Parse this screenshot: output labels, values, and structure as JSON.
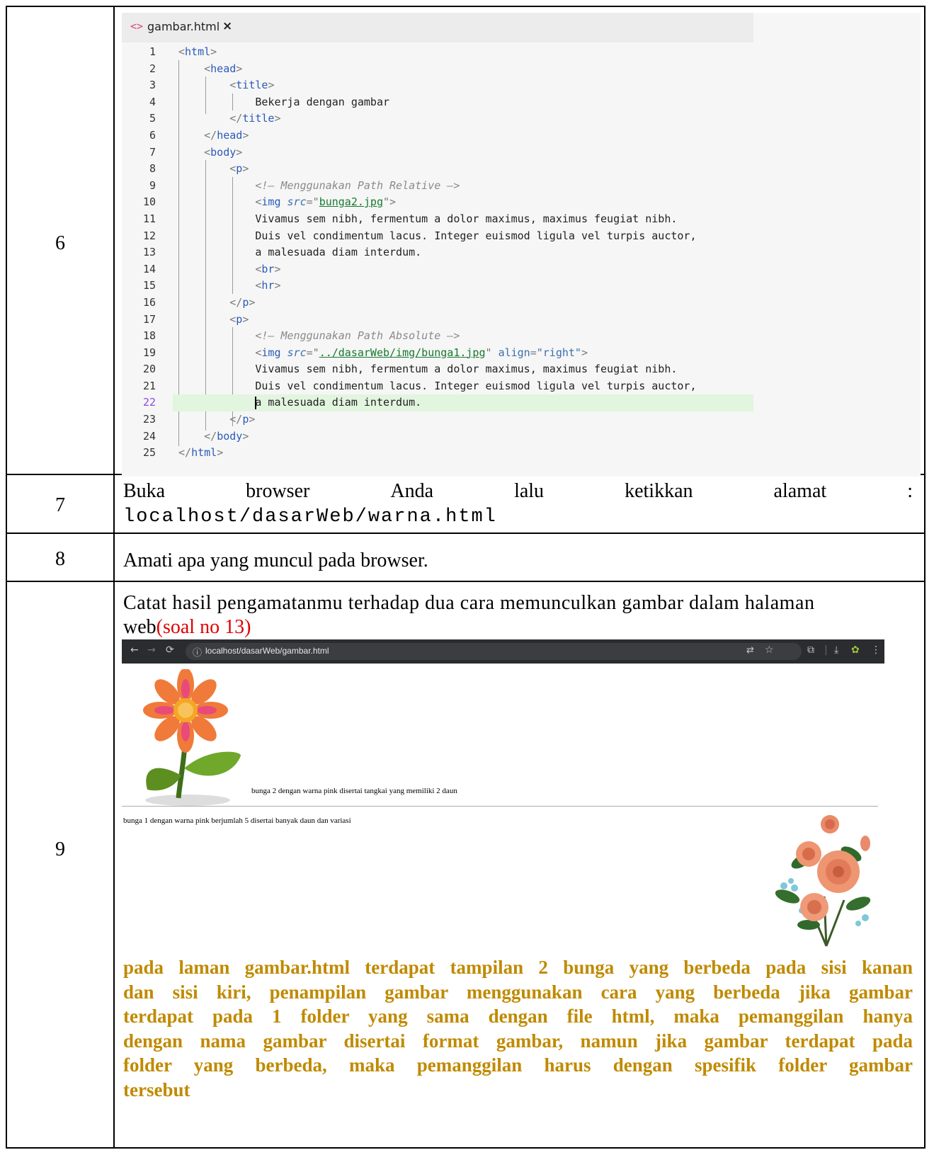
{
  "rows": {
    "r6": "6",
    "r7": "7",
    "r8": "8",
    "r9": "9"
  },
  "editor": {
    "tab_label": "gambar.html",
    "tab_close": "×",
    "tab_icon": "code-file-icon"
  },
  "step7": {
    "words": [
      "Buka",
      "browser",
      "Anda",
      "lalu",
      "ketikkan",
      "alamat",
      ":"
    ],
    "url": "localhost/dasarWeb/warna.html"
  },
  "step8": {
    "text": "Amati apa yang muncul pada browser."
  },
  "step9": {
    "line1": "Catat hasil pengamatanmu terhadap dua cara memunculkan gambar dalam halaman",
    "line2_black": "web",
    "line2_red": "(soal no 13)",
    "answer": [
      "pada laman gambar.html terdapat tampilan 2 bunga yang berbeda pada sisi kanan",
      "dan sisi kiri, penampilan gambar menggunakan cara yang berbeda jika gambar",
      "terdapat pada 1 folder yang sama dengan file html, maka pemanggilan hanya",
      "dengan nama gambar disertai format gambar, namun jika gambar terdapat pada",
      "folder yang berbeda, maka pemanggilan harus dengan spesifik folder gambar",
      "tersebut"
    ]
  },
  "browser": {
    "url": "localhost/dasarWeb/gambar.html",
    "caption1": "bunga 2 dengan warna pink disertai tangkai yang memiliki 2 daun",
    "caption2": "bunga 1 dengan warna pink berjumlah 5 disertai banyak daun dan variasi"
  },
  "colors": {
    "answer": "#c08a00",
    "red": "#e00000"
  }
}
